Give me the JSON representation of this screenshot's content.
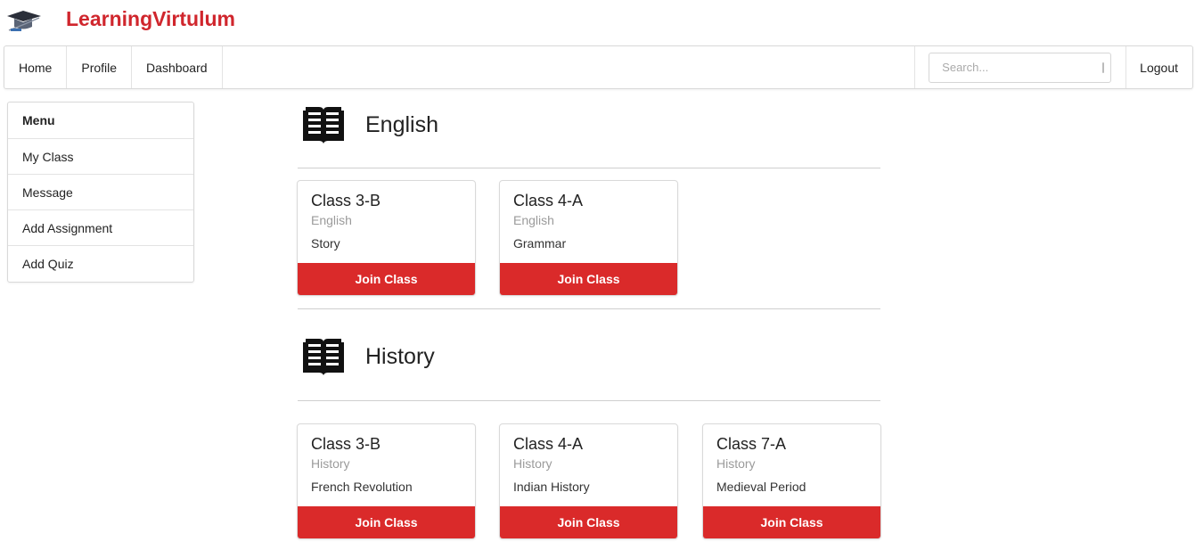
{
  "brand": {
    "name": "LearningVirtulum",
    "logo_icon": "graduation-cap-logo",
    "accent_color": "#d0262d"
  },
  "navbar": {
    "items": [
      {
        "label": "Home"
      },
      {
        "label": "Profile"
      },
      {
        "label": "Dashboard"
      }
    ],
    "search": {
      "placeholder": "Search...",
      "icon": "search-icon"
    },
    "logout": "Logout"
  },
  "sidebar": {
    "header": "Menu",
    "items": [
      {
        "label": "My Class"
      },
      {
        "label": "Message"
      },
      {
        "label": "Add Assignment"
      },
      {
        "label": "Add Quiz"
      }
    ]
  },
  "sections": [
    {
      "title": "English",
      "icon": "open-book-icon",
      "cards": [
        {
          "title": "Class 3-B",
          "subject": "English",
          "topic": "Story",
          "button": "Join Class"
        },
        {
          "title": "Class 4-A",
          "subject": "English",
          "topic": "Grammar",
          "button": "Join Class"
        }
      ]
    },
    {
      "title": "History",
      "icon": "open-book-icon",
      "cards": [
        {
          "title": "Class 3-B",
          "subject": "History",
          "topic": "French Revolution",
          "button": "Join Class"
        },
        {
          "title": "Class 4-A",
          "subject": "History",
          "topic": "Indian History",
          "button": "Join Class"
        },
        {
          "title": "Class 7-A",
          "subject": "History",
          "topic": "Medieval Period",
          "button": "Join Class"
        }
      ]
    }
  ],
  "colors": {
    "button": "#da2a2a",
    "muted_text": "#9b9b9b"
  }
}
